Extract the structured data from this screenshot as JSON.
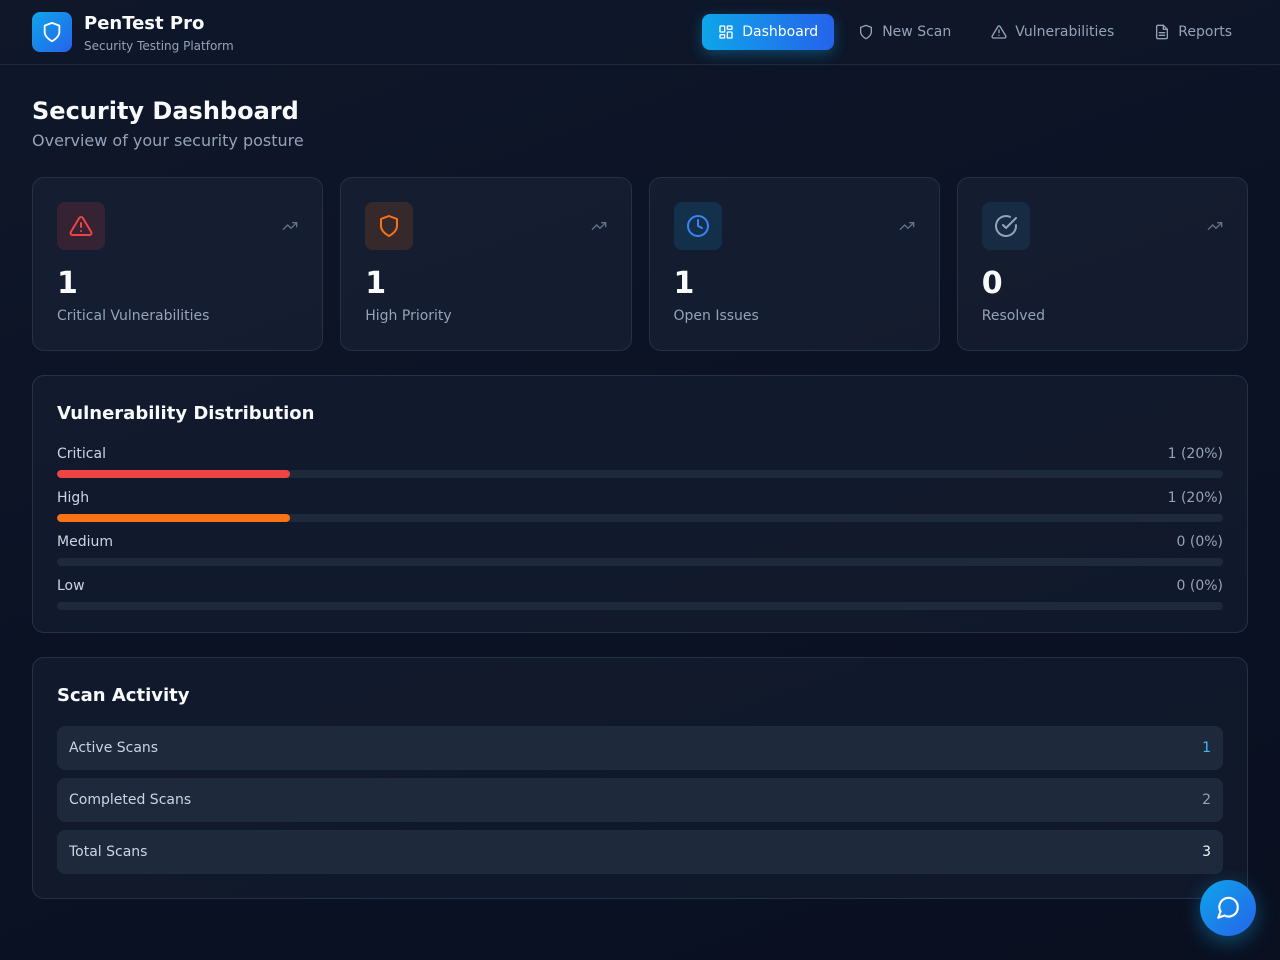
{
  "app": {
    "title": "PenTest Pro",
    "subtitle": "Security Testing Platform",
    "logo_icon": "shield-icon"
  },
  "nav": {
    "items": [
      {
        "label": "Dashboard",
        "icon": "grid-icon",
        "active": true
      },
      {
        "label": "New Scan",
        "icon": "shield-icon",
        "active": false
      },
      {
        "label": "Vulnerabilities",
        "icon": "warning-icon",
        "active": false
      },
      {
        "label": "Reports",
        "icon": "document-icon",
        "active": false
      }
    ]
  },
  "page": {
    "title": "Security Dashboard",
    "subtitle": "Overview of your security posture"
  },
  "stats": [
    {
      "value": "1",
      "label": "Critical Vulnerabilities",
      "icon": "alert-triangle-icon",
      "color": "#ef4444"
    },
    {
      "value": "1",
      "label": "High Priority",
      "icon": "shield-icon",
      "color": "#f97316"
    },
    {
      "value": "1",
      "label": "Open Issues",
      "icon": "clock-icon",
      "color": "#3b82f6"
    },
    {
      "value": "0",
      "label": "Resolved",
      "icon": "check-circle-icon",
      "color": "#94a3b8"
    }
  ],
  "distribution": {
    "title": "Vulnerability Distribution",
    "rows": [
      {
        "label": "Critical",
        "value": "1 (20%)",
        "percent": 20,
        "color": "#ef4444"
      },
      {
        "label": "High",
        "value": "1 (20%)",
        "percent": 20,
        "color": "#f97316"
      },
      {
        "label": "Medium",
        "value": "0 (0%)",
        "percent": 0,
        "color": "#eab308"
      },
      {
        "label": "Low",
        "value": "0 (0%)",
        "percent": 0,
        "color": "#22c55e"
      }
    ]
  },
  "scan_activity": {
    "title": "Scan Activity",
    "rows": [
      {
        "label": "Active Scans",
        "value": "1",
        "color": "#38bdf8"
      },
      {
        "label": "Completed Scans",
        "value": "2",
        "color": "#94a3b8"
      },
      {
        "label": "Total Scans",
        "value": "3",
        "color": "#f1f5f9"
      }
    ]
  },
  "chat_button_icon": "chat-bubble-icon"
}
